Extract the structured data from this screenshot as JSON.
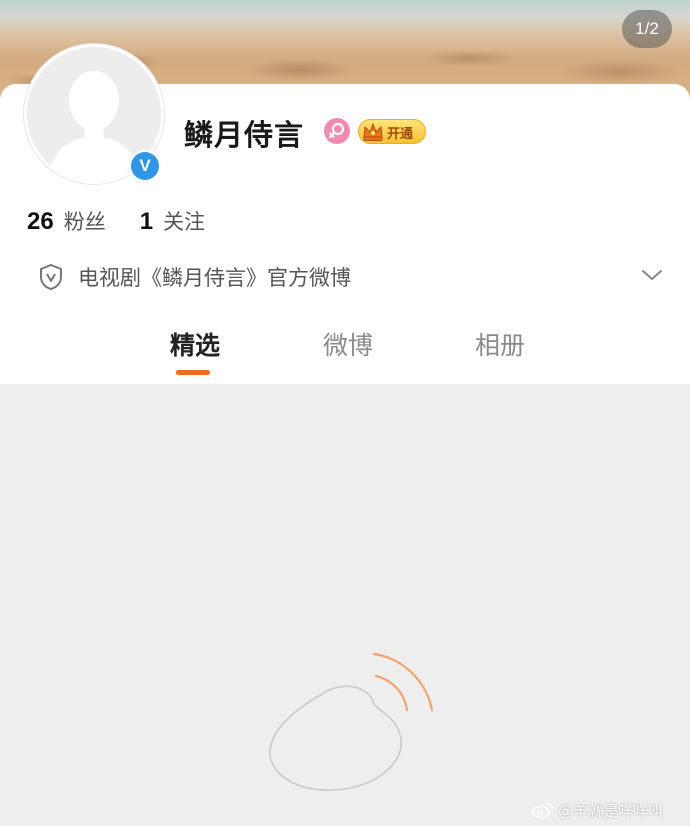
{
  "header": {
    "page_indicator": "1/2"
  },
  "profile": {
    "username": "鳞月侍言",
    "avatar_icon": "default-avatar-icon",
    "verified_icon": "verified-v-icon",
    "verified_letter": "V",
    "gender_icon": "female-gender-icon",
    "vip_badge": {
      "icon": "crown-icon",
      "label": "开通"
    },
    "stats": {
      "followers_count": "26",
      "followers_label": "粉丝",
      "following_count": "1",
      "following_label": "关注"
    },
    "intro": {
      "icon": "shield-v-icon",
      "text": "电视剧《鳞月侍言》官方微博",
      "expand_icon": "chevron-down-icon"
    }
  },
  "tabs": {
    "items": [
      {
        "label": "精选",
        "active": true
      },
      {
        "label": "微博",
        "active": false
      },
      {
        "label": "相册",
        "active": false
      }
    ]
  },
  "content": {
    "loading_icon": "weibo-logo-icon"
  },
  "watermark": {
    "icon": "weibo-icon",
    "text": "@羊就是咩咩叫"
  },
  "colors": {
    "accent": "#f26a1b",
    "verified": "#2e96e6",
    "gender": "#f18aae",
    "vip_gold": "#f7c132",
    "background": "#eeeeee"
  }
}
